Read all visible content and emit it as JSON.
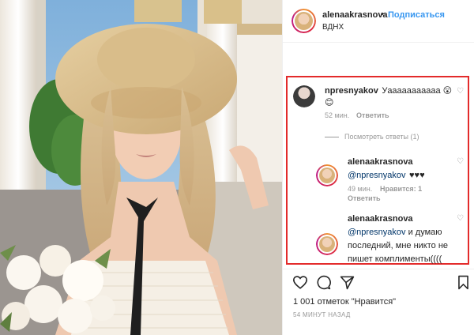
{
  "post": {
    "author": "alenaakrasnova",
    "separator": "•",
    "follow_label": "Подписаться",
    "location": "ВДНХ"
  },
  "comments": [
    {
      "user": "npresnyakov",
      "text": "Уааааааааааа 😲",
      "text2": "😊",
      "time": "52 мин.",
      "reply_label": "Ответить",
      "view_replies": "Посмотреть ответы (1)"
    },
    {
      "user": "alenaakrasnova",
      "mention": "@npresnyakov",
      "text": "♥♥♥",
      "time": "49 мин.",
      "likes": "Нравится: 1",
      "reply_label": "Ответить"
    },
    {
      "user": "alenaakrasnova",
      "mention": "@npresnyakov",
      "text_a": " и думаю",
      "text_b": "последний, мне никто не",
      "text_c": "пишет комплименты(((("
    }
  ],
  "footer": {
    "likes_text": "1 001 отметок \"Нравится\"",
    "timestamp": "54 МИНУТ НАЗАД"
  },
  "icons": {
    "heart": "heart-icon",
    "comment": "comment-icon",
    "share": "share-icon",
    "bookmark": "bookmark-icon",
    "more": "more-icon"
  },
  "colors": {
    "link_blue": "#3897f0",
    "mention_blue": "#003569",
    "highlight_red": "#e32b2b",
    "meta_gray": "#999999"
  }
}
